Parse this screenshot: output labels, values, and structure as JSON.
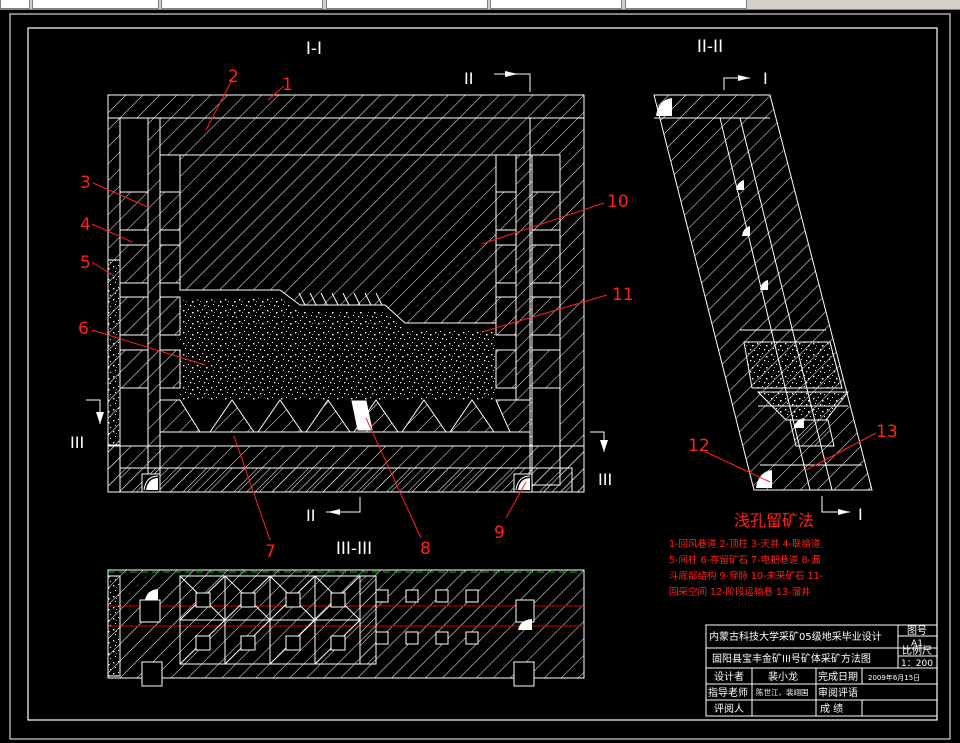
{
  "sections": {
    "main": "I-I",
    "side": "II-II",
    "plan": "III-III"
  },
  "section_marks": {
    "ii_top": "II",
    "ii_bottom": "II",
    "iii_left": "III",
    "iii_right": "III",
    "i_top": "I",
    "i_bottom": "I"
  },
  "callouts": {
    "n1": "1",
    "n2": "2",
    "n3": "3",
    "n4": "4",
    "n5": "5",
    "n6": "6",
    "n7": "7",
    "n8": "8",
    "n9": "9",
    "n10": "10",
    "n11": "11",
    "n12": "12",
    "n13": "13"
  },
  "legend": {
    "title": "浅孔留矿法",
    "lines": [
      "1-回风巷道  2-顶柱  3-天井  4-联络道",
      "5-间柱  6-存留矿石  7-电耙巷道  8-漏",
      "斗底部结构  9-穿脉  10-未采矿石  11-",
      "回采空间  12-阶段运输巷  13-溜井"
    ]
  },
  "title_block": {
    "school": "内蒙古科技大学采矿05级地采毕业设计",
    "drawing_no_label": "图号",
    "drawing_no": "A1",
    "project": "固阳县宝丰金矿III号矿体采矿方法图",
    "scale_label": "比例尺",
    "scale": "1：200",
    "designer_label": "设计者",
    "designer": "裴小龙",
    "date_label": "完成日期",
    "date": "2009年6月15日",
    "advisor_label": "指导老师",
    "advisor": "陈世江、裴翊国",
    "review_label": "审阅评语",
    "reviewer_label": "评阅人",
    "grade_label": "成    绩"
  },
  "colors": {
    "background": "#000000",
    "lines": "#ffffff",
    "callouts": "#ff2020",
    "plan_dashed_green": "#00c000",
    "plan_red_lines": "#d00000"
  }
}
